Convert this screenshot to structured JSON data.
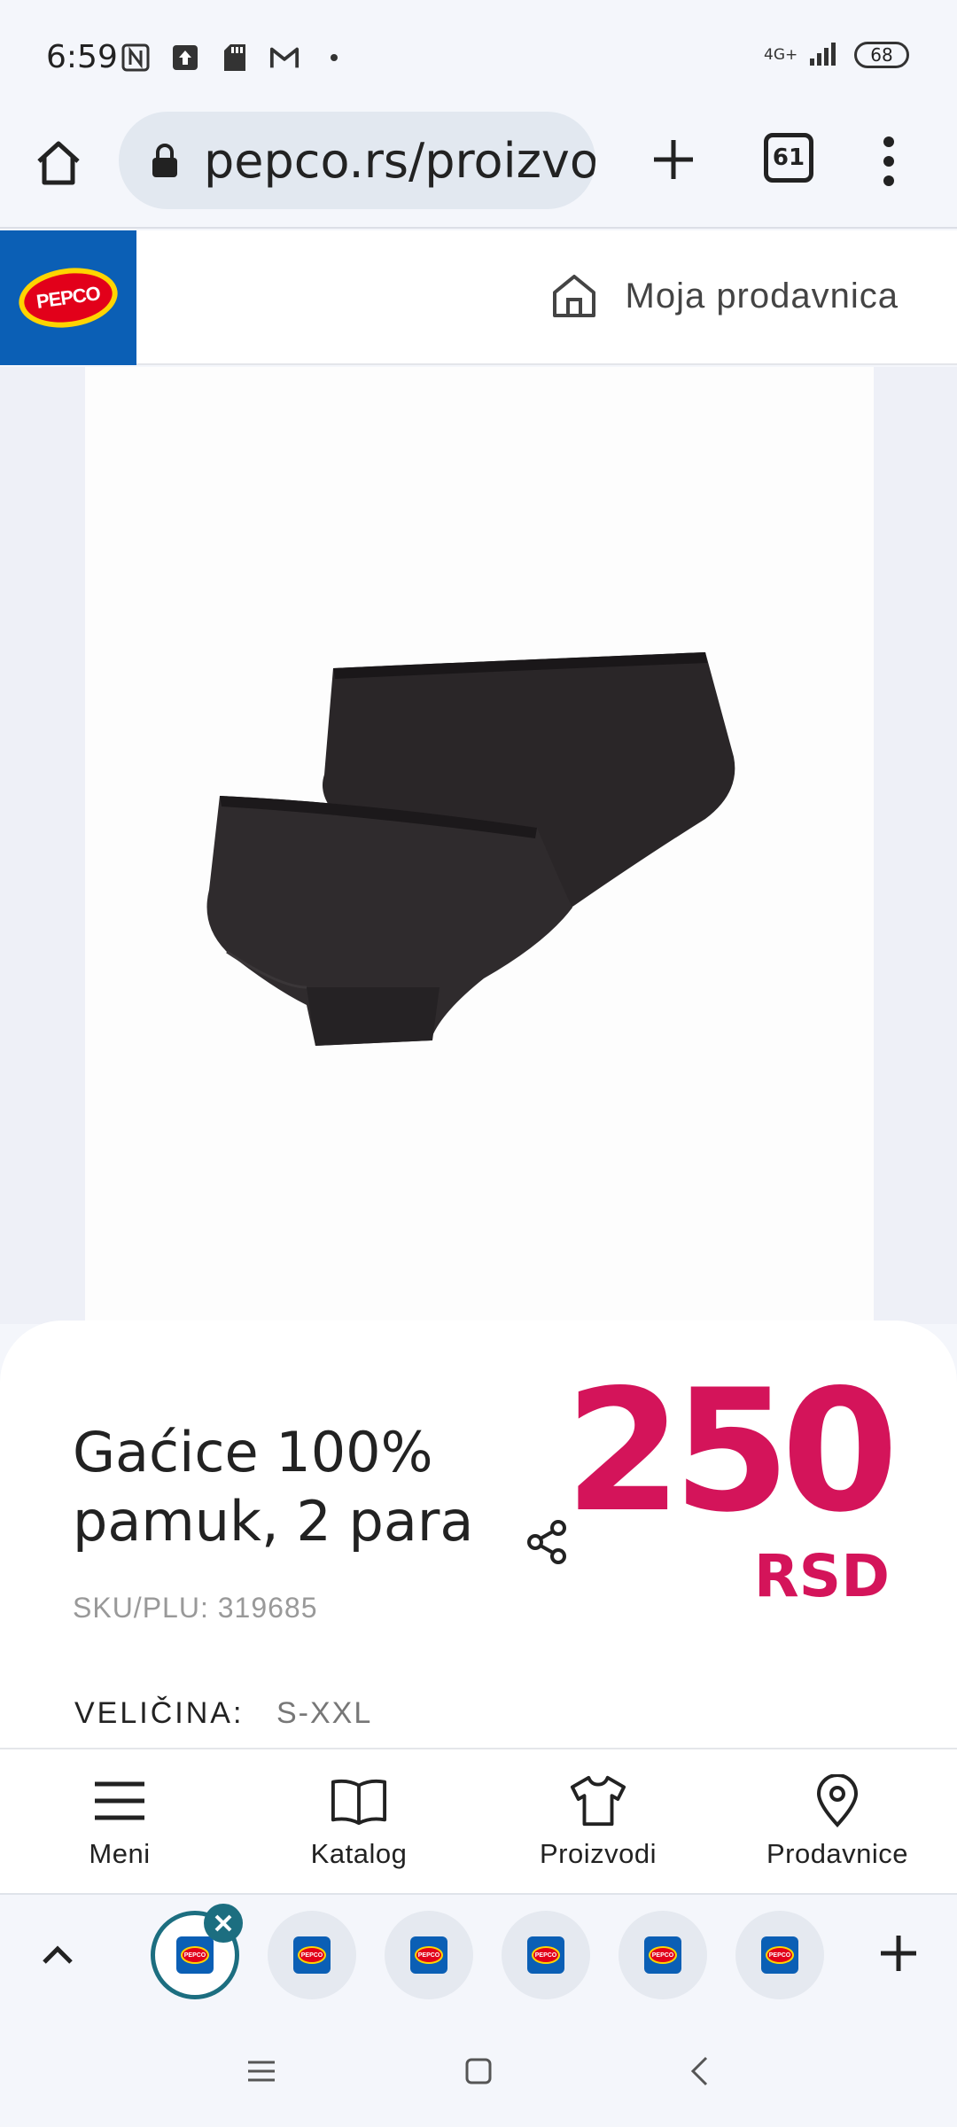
{
  "status_bar": {
    "time": "6:59",
    "network": "4G+",
    "battery": "68"
  },
  "browser": {
    "url": "pepco.rs/proizvodi",
    "tab_count": "61"
  },
  "header": {
    "logo_text": "PEPCO",
    "store_label": "Moja prodavnica",
    "brand_color": "#0b5fb5"
  },
  "product": {
    "title": "Gaćice 100% pamuk, 2 para",
    "price": "250",
    "currency": "RSD",
    "sku": "SKU/PLU: 319685",
    "size_label": "VELIČINA:",
    "size_value": "S-XXL",
    "price_color": "#d4145a"
  },
  "bottom_nav": {
    "items": [
      {
        "label": "Meni",
        "icon": "hamburger-icon"
      },
      {
        "label": "Katalog",
        "icon": "book-icon"
      },
      {
        "label": "Proizvodi",
        "icon": "tshirt-icon"
      },
      {
        "label": "Prodavnice",
        "icon": "location-pin-icon"
      }
    ]
  },
  "tab_strip": {
    "tabs": [
      "PEPCO",
      "PEPCO",
      "PEPCO",
      "PEPCO",
      "PEPCO",
      "PEPCO"
    ]
  }
}
